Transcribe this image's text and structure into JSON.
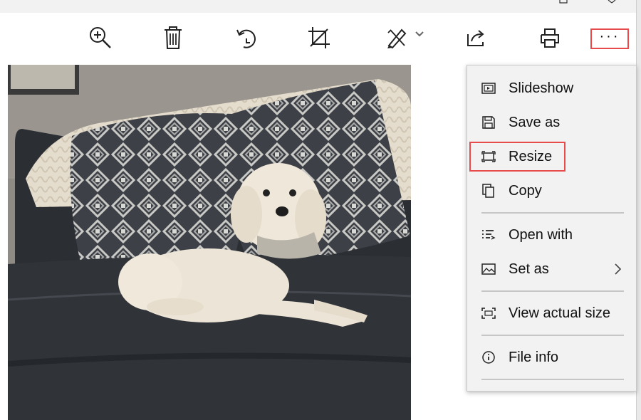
{
  "window": {
    "controls": [
      {
        "name": "restore",
        "icon": "restore-icon"
      },
      {
        "name": "close",
        "icon": "close-icon"
      }
    ]
  },
  "toolbar": {
    "buttons": [
      {
        "name": "zoom",
        "icon": "zoom-in-icon"
      },
      {
        "name": "delete",
        "icon": "trash-icon"
      },
      {
        "name": "rotate",
        "icon": "rotate-icon"
      },
      {
        "name": "crop",
        "icon": "crop-icon"
      },
      {
        "name": "edit",
        "icon": "edit-draw-icon"
      },
      {
        "name": "share",
        "icon": "share-icon"
      },
      {
        "name": "print",
        "icon": "printer-icon"
      }
    ],
    "more_label": "···",
    "highlight_color": "#e84b4b"
  },
  "photo": {
    "subject": "dog-on-sofa-photo"
  },
  "menu": {
    "items": [
      {
        "label": "Slideshow",
        "icon": "slideshow-icon"
      },
      {
        "label": "Save as",
        "icon": "save-icon"
      },
      {
        "label": "Resize",
        "icon": "resize-icon",
        "highlighted": true
      },
      {
        "label": "Copy",
        "icon": "copy-icon"
      },
      {
        "label": "Open with",
        "icon": "open-with-icon"
      },
      {
        "label": "Set as",
        "icon": "set-as-icon",
        "submenu": true
      },
      {
        "label": "View actual size",
        "icon": "actual-size-icon"
      },
      {
        "label": "File info",
        "icon": "info-icon"
      }
    ]
  }
}
